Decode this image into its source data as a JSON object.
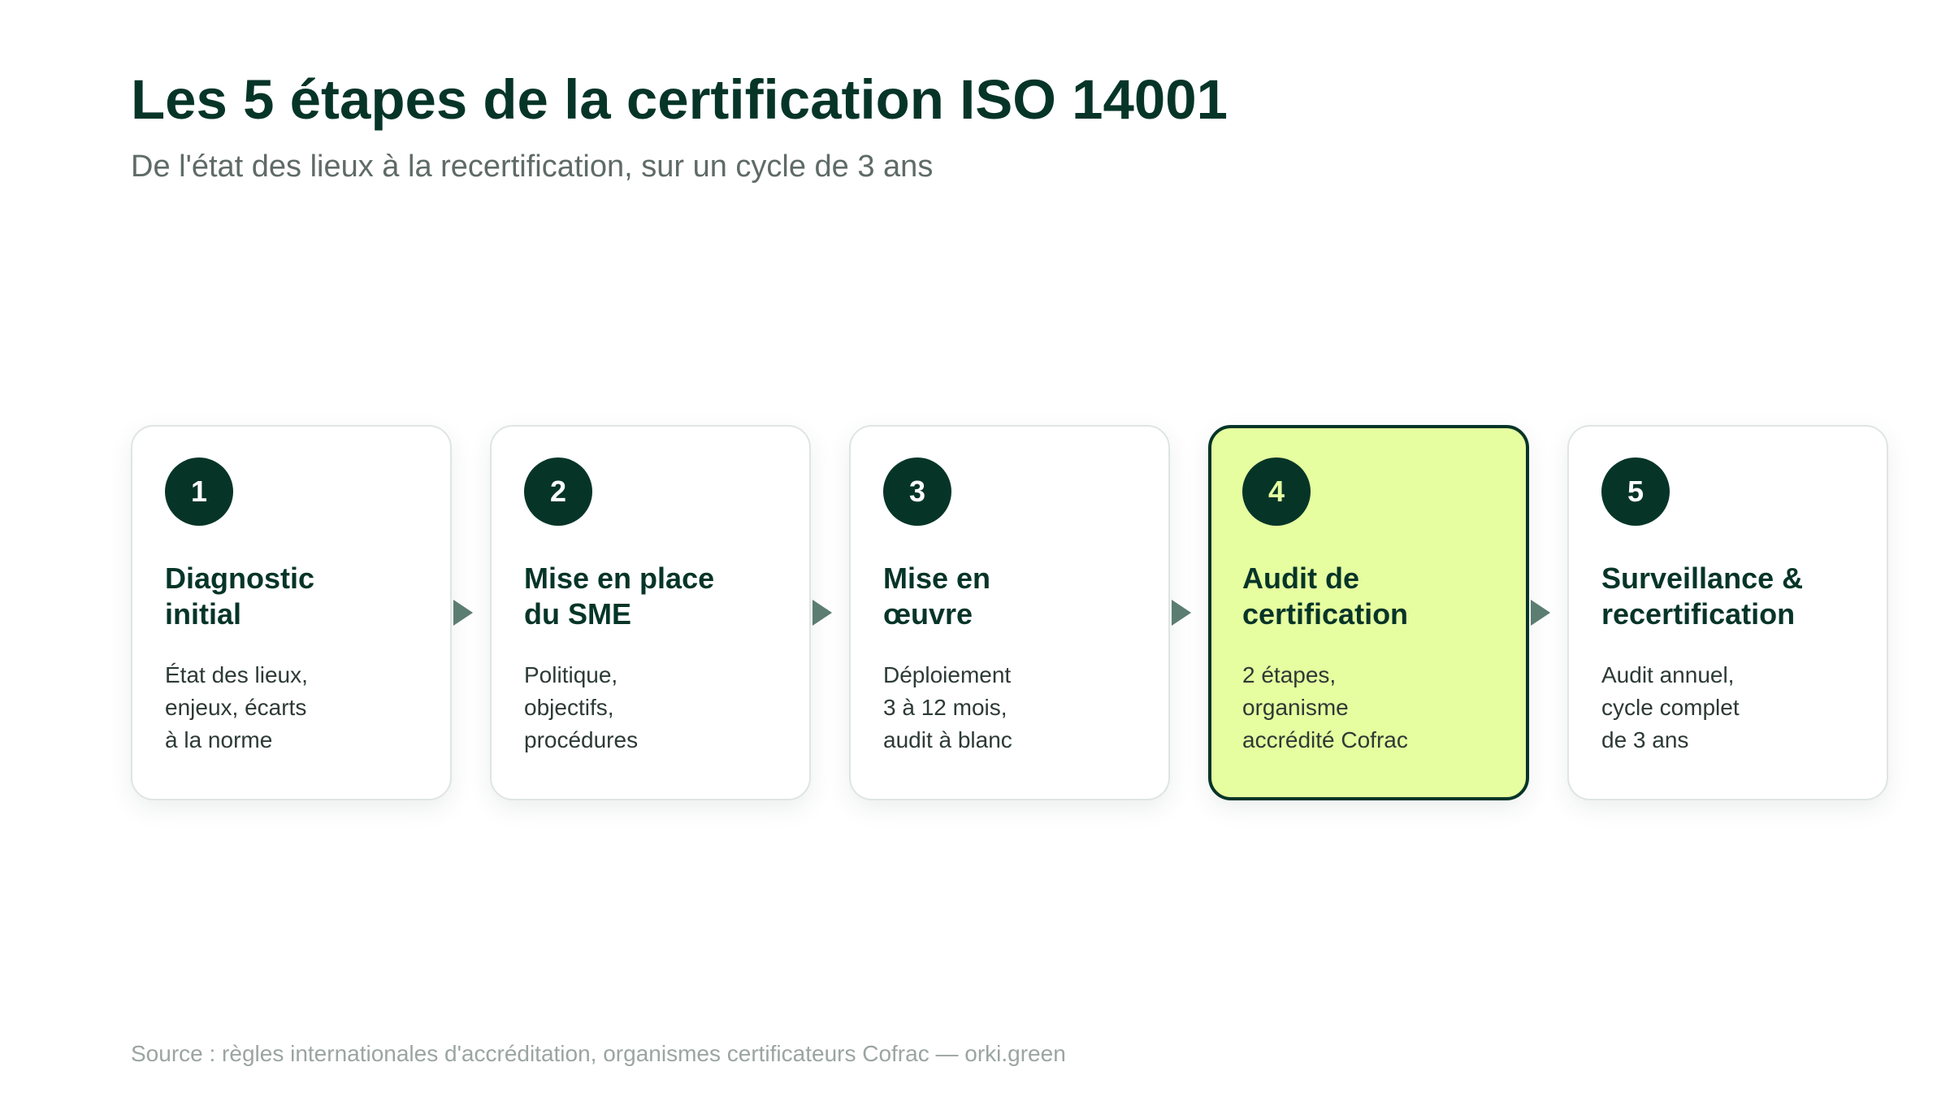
{
  "header": {
    "title": "Les 5 étapes de la certification ISO 14001",
    "subtitle": "De l'état des lieux à la recertification, sur un cycle de 3 ans"
  },
  "steps": [
    {
      "number": "1",
      "title_lines": [
        "Diagnostic",
        "initial"
      ],
      "desc_lines": [
        "État des lieux,",
        "enjeux, écarts",
        "à la norme"
      ]
    },
    {
      "number": "2",
      "title_lines": [
        "Mise en place",
        "du SME"
      ],
      "desc_lines": [
        "Politique,",
        "objectifs,",
        "procédures"
      ]
    },
    {
      "number": "3",
      "title_lines": [
        "Mise en",
        "œuvre"
      ],
      "desc_lines": [
        "Déploiement",
        "3 à 12 mois,",
        "audit à blanc"
      ]
    },
    {
      "number": "4",
      "highlighted": true,
      "title_lines": [
        "Audit de",
        "certification"
      ],
      "desc_lines": [
        "2 étapes,",
        "organisme",
        "accrédité Cofrac"
      ]
    },
    {
      "number": "5",
      "title_lines": [
        "Surveillance &",
        "recertification"
      ],
      "desc_lines": [
        "Audit annuel,",
        "cycle complet",
        "de 3 ans"
      ]
    }
  ],
  "footer": {
    "source": "Source : règles internationales d'accréditation, organismes certificateurs Cofrac — orki.green"
  },
  "colors": {
    "primary": "#063528",
    "highlight": "#e6fda0",
    "arrow": "#5b7d72",
    "subtitle": "#5f6b66",
    "source": "#9ba5a1"
  }
}
